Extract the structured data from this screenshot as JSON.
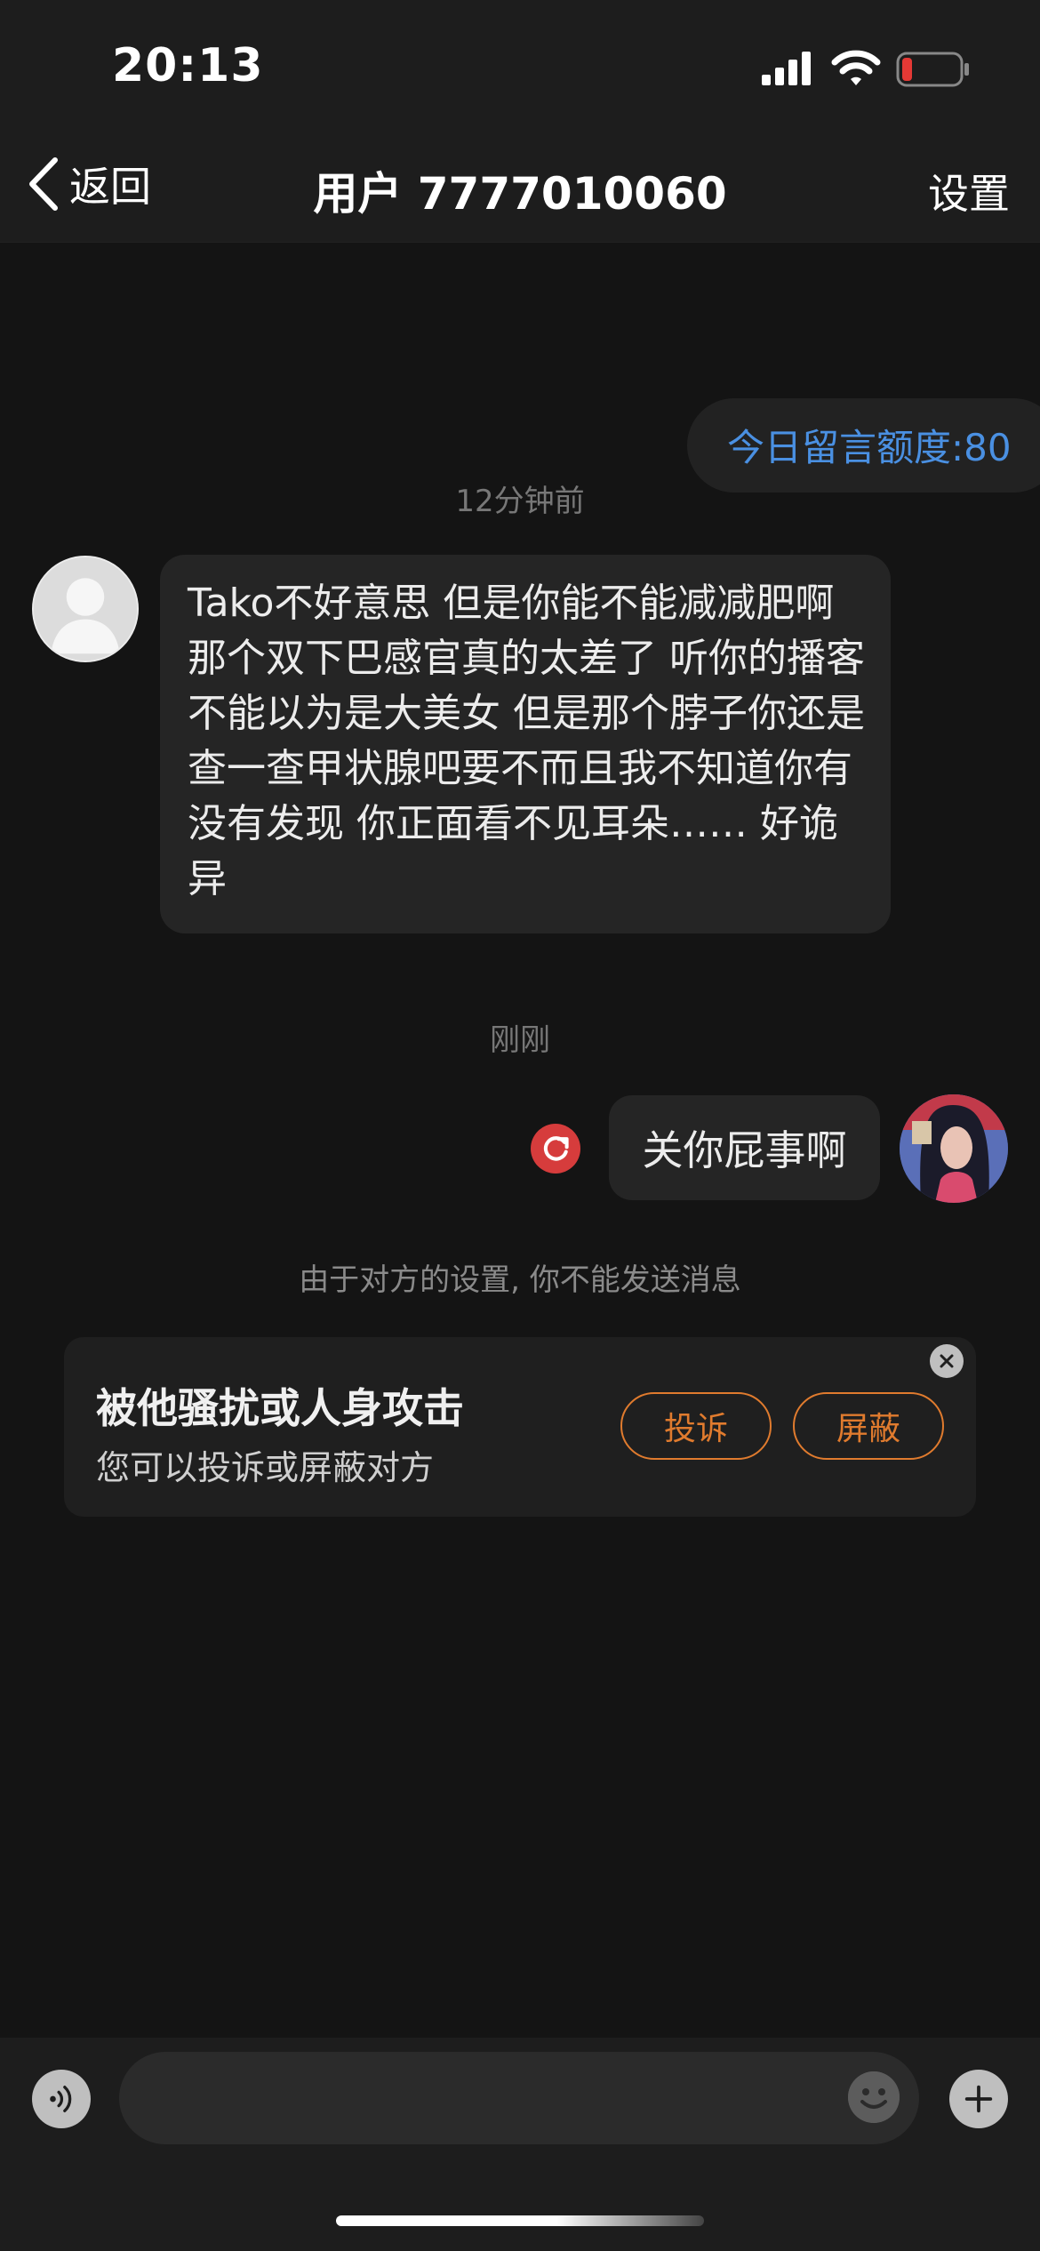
{
  "status_bar": {
    "time": "20:13",
    "signal_icon": "cellular-signal-icon",
    "wifi_icon": "wifi-icon",
    "battery_icon": "battery-low-icon",
    "battery_level_color": "#e53935"
  },
  "nav": {
    "back_icon": "chevron-left-icon",
    "back_label": "返回",
    "title": "用户 7777010060",
    "settings_label": "设置"
  },
  "chat": {
    "quota_text": "今日留言额度:80",
    "messages": [
      {
        "timestamp": "12分钟前",
        "direction": "incoming",
        "text": "Tako不好意思 但是你能不能减减肥啊  那个双下巴感官真的太差了  听你的播客不能以为是大美女 但是那个脖子你还是查一查甲状腺吧要不而且我不知道你有没有发现 你正面看不见耳朵…… 好诡异"
      },
      {
        "timestamp": "刚刚",
        "direction": "outgoing",
        "text": "关你屁事啊",
        "failed": true
      }
    ],
    "blocked_notice": "由于对方的设置, 你不能发送消息"
  },
  "report_card": {
    "title": "被他骚扰或人身攻击",
    "subtitle": "您可以投诉或屏蔽对方",
    "complain_label": "投诉",
    "block_label": "屏蔽",
    "accent_color": "#e07b2e"
  },
  "input_bar": {
    "voice_icon": "voice-icon",
    "placeholder": "",
    "emoji_icon": "emoji-icon",
    "plus_icon": "plus-icon"
  },
  "colors": {
    "background": "#141414",
    "bubble": "#252525",
    "quota_blue": "#4a90e2",
    "retry_red": "#d63c3c"
  }
}
